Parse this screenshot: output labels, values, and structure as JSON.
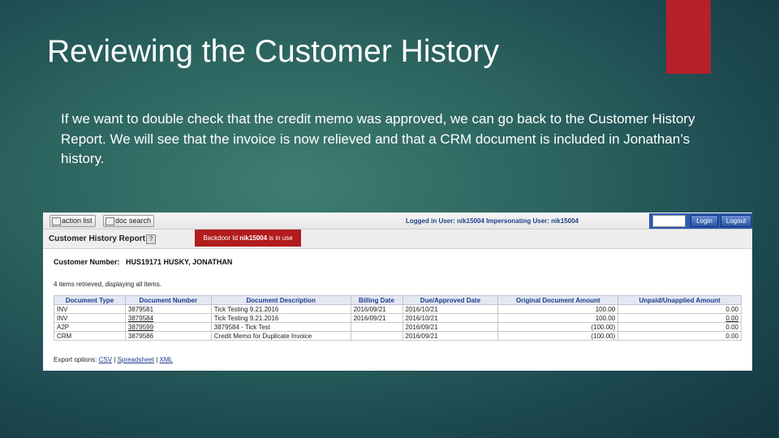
{
  "slide": {
    "title": "Reviewing the Customer History",
    "body": "If we want to double check that the credit memo was approved, we can go back to the Customer History Report.  We will see that the invoice is now relieved and that a CRM document is included in Jonathan’s history.",
    "accent_color": "#b5202a"
  },
  "app": {
    "toolbar": {
      "action_list": "action list",
      "doc_search": "doc search",
      "logged_in": "Logged in User: nik15004   Impersonating User: nik15004",
      "login_label": "Login",
      "logout_label": "Logout"
    },
    "page_title": "Customer History Report",
    "help": "?",
    "backdoor_prefix": "Backdoor Id",
    "backdoor_id": "nik15004",
    "backdoor_suffix": "is in use",
    "customer_label": "Customer Number:",
    "customer_value": "HUS19171  HUSKY, JONATHAN",
    "items_text": "4 items retrieved, displaying all items.",
    "columns": [
      "Document Type",
      "Document Number",
      "Document Description",
      "Billing Date",
      "Due/Approved Date",
      "Original Document Amount",
      "Unpaid/Unapplied Amount"
    ],
    "rows": [
      [
        "INV",
        "3879581",
        "Tick Testing 9.21.2016",
        "2016/09/21",
        "2016/10/21",
        "100.00",
        "0.00"
      ],
      [
        "INV",
        "3879584",
        "Tick Testing 9.21.2016",
        "2016/09/21",
        "2016/10/21",
        "100.00",
        "0.00"
      ],
      [
        "A2P",
        "3879599",
        "3879584 - Tick Test",
        "",
        "2016/09/21",
        "(100.00)",
        "0.00"
      ],
      [
        "CRM",
        "3879586",
        "Credit Memo for Duplicate Invoice",
        "",
        "2016/09/21",
        "(100.00)",
        "0.00"
      ]
    ],
    "export_label": "Export options:",
    "export_csv": "CSV",
    "export_spreadsheet": "Spreadsheet",
    "export_xml": "XML"
  }
}
